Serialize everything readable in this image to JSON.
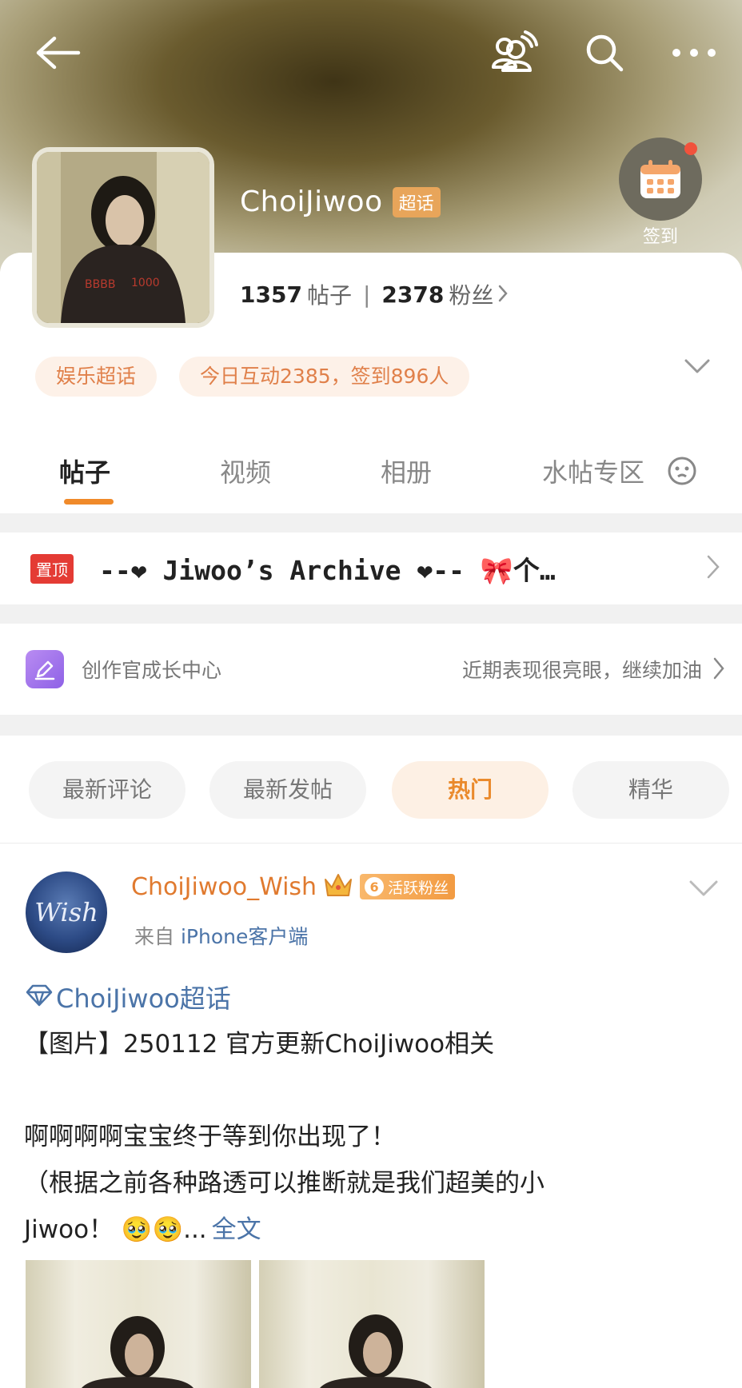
{
  "header": {
    "title": "ChoiJiwoo",
    "super_badge": "超话",
    "checkin_label": "签到"
  },
  "stats": {
    "posts_count": "1357",
    "posts_unit": "帖子",
    "fans_count": "2378",
    "fans_unit": "粉丝"
  },
  "tags": [
    "娱乐超话",
    "今日互动2385，签到896人"
  ],
  "tabs": [
    "帖子",
    "视频",
    "相册",
    "水帖专区"
  ],
  "pinned": {
    "badge": "置顶",
    "text": "--❤ Jiwoo’s Archive ❤-- 🎀个…"
  },
  "creator_center": {
    "label": "创作官成长中心",
    "message": "近期表现很亮眼，继续加油"
  },
  "filters": [
    "最新评论",
    "最新发帖",
    "热门",
    "精华"
  ],
  "post": {
    "user_name": "ChoiJiwoo_Wish",
    "fan_level": "6",
    "fan_badge": "活跃粉丝",
    "source_prefix": "来自",
    "source_client": "iPhone客户端",
    "avatar_text": "Wish",
    "topic": "ChoiJiwoo超话",
    "line1": "【图片】250112 官方更新ChoiJiwoo相关",
    "line2": "啊啊啊啊宝宝终于等到你出现了！",
    "line3": "（根据之前各种路透可以推断就是我们超美的小",
    "line4": "Jiwoo！ 🥹🥹...",
    "full_text_link": "全文"
  },
  "colors": {
    "accent_orange": "#f08a2a",
    "link_blue": "#4b74a8",
    "pinned_red": "#e43b34"
  }
}
